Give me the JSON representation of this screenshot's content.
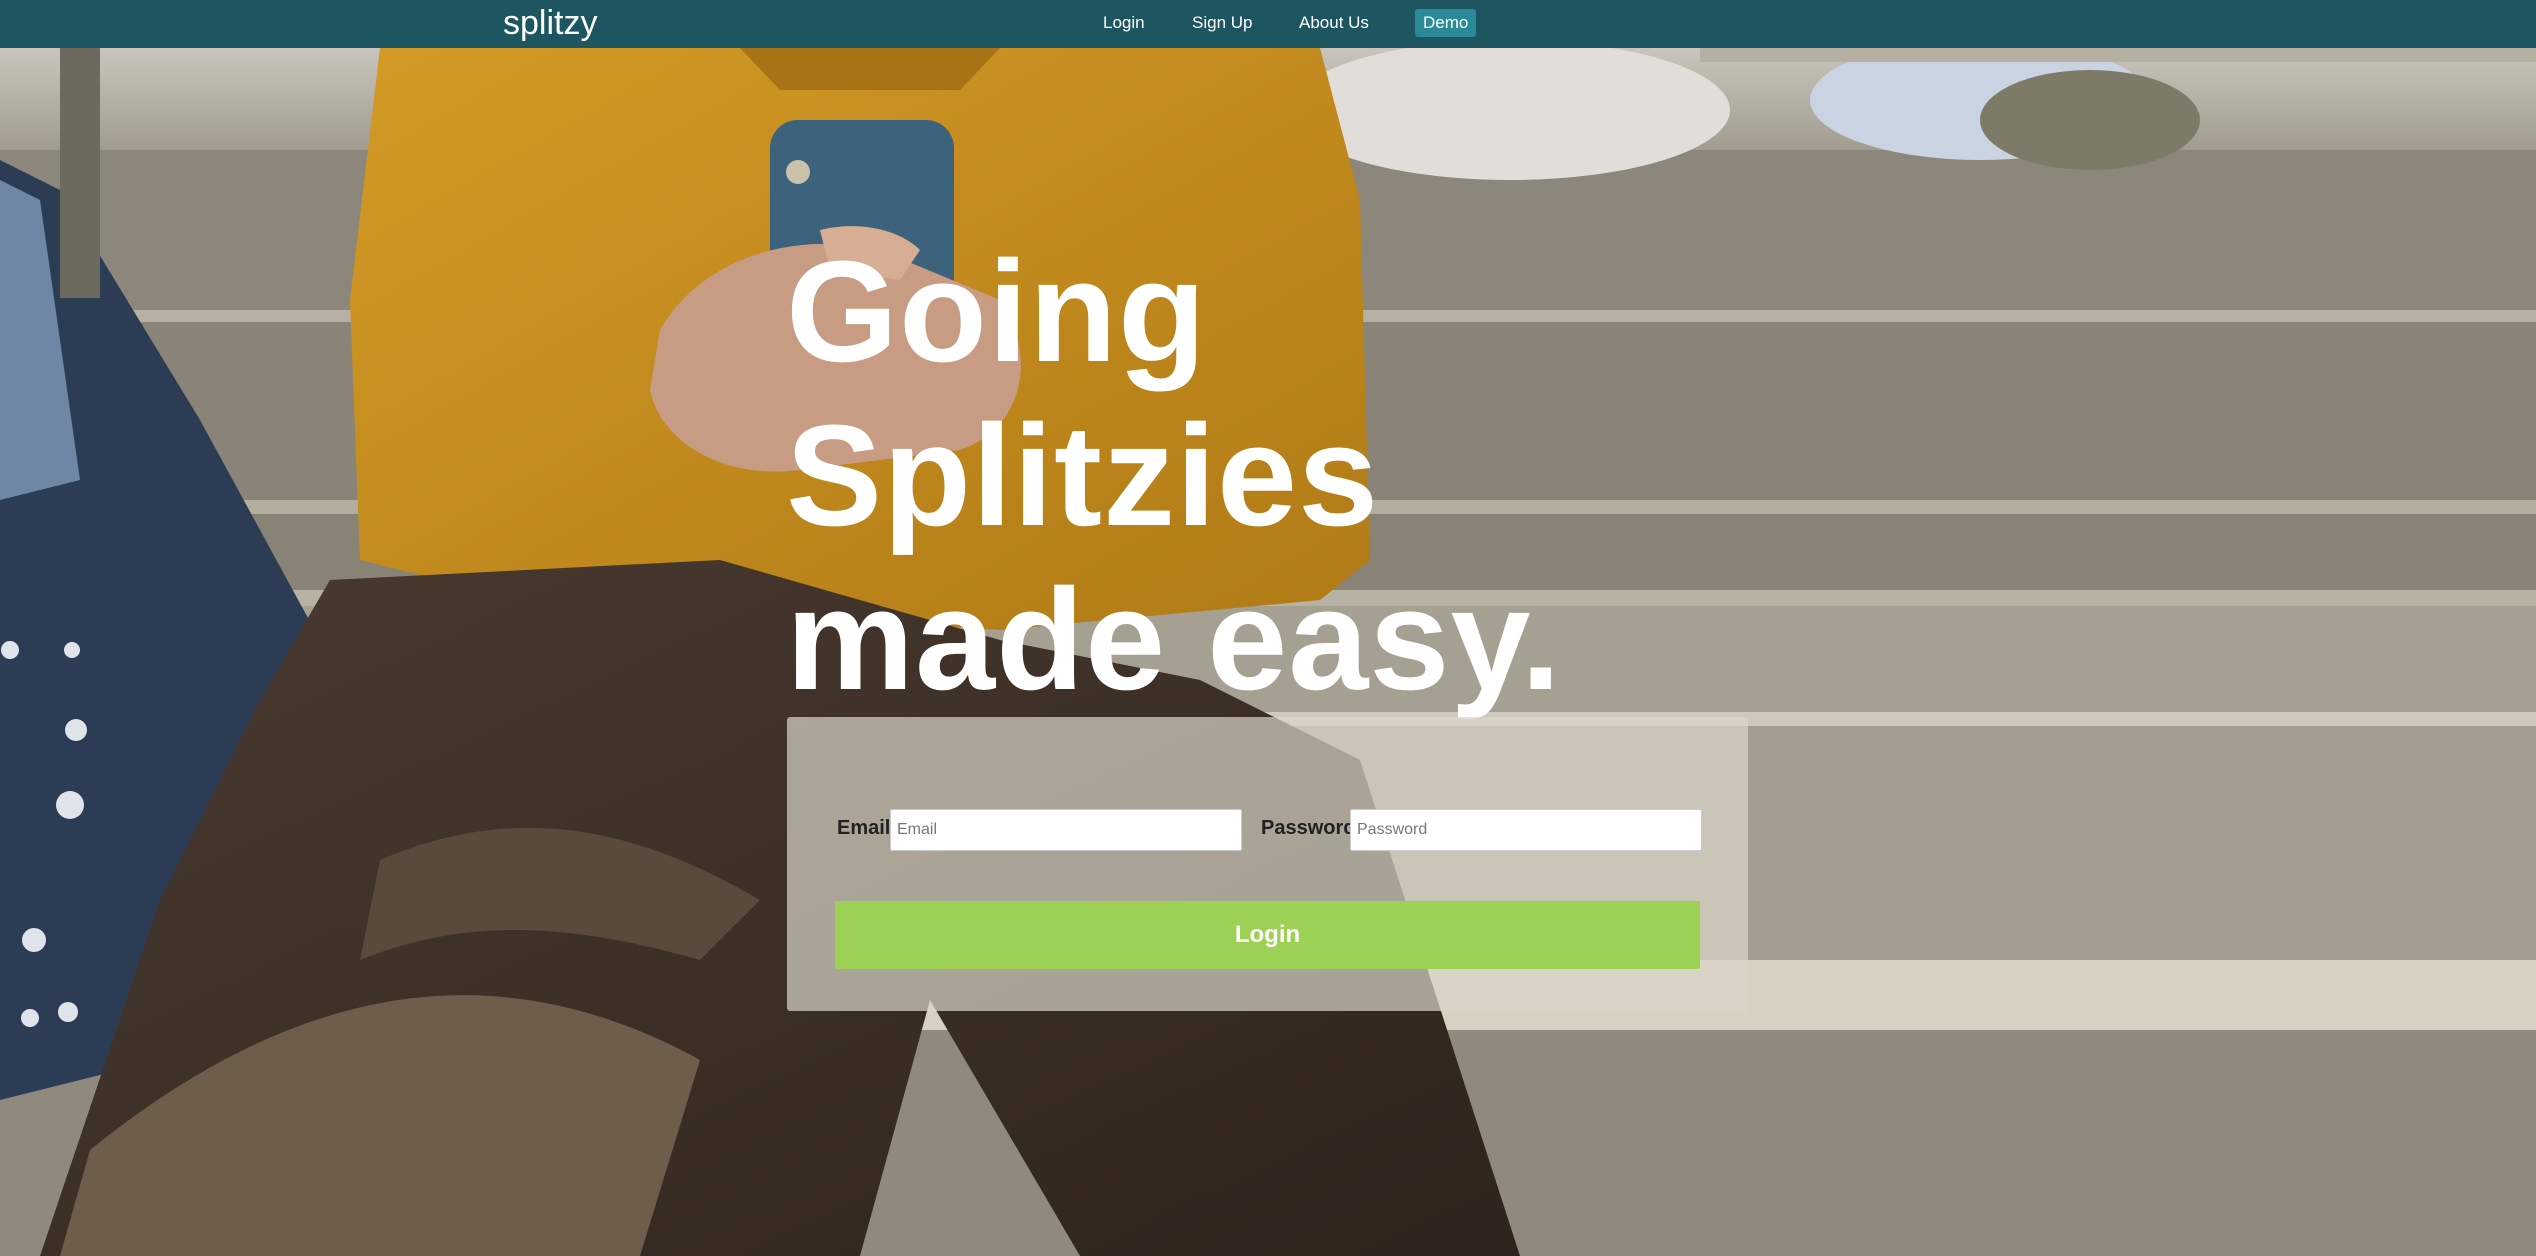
{
  "navbar": {
    "brand": "splitzy",
    "links": {
      "login": "Login",
      "signup": "Sign Up",
      "about": "About Us",
      "demo": "Demo"
    },
    "colors": {
      "background": "#1d5661",
      "demo_badge": "#2a8a98"
    }
  },
  "hero": {
    "headline_lines": [
      "Going",
      "Splitzies",
      "made easy."
    ]
  },
  "login_form": {
    "email_label": "Email",
    "email_placeholder": "Email",
    "password_label": "Password",
    "password_placeholder": "Password",
    "submit_label": "Login",
    "colors": {
      "submit": "#9dd155"
    }
  },
  "background": {
    "description_icon": "photo-person-on-stairs-with-phone"
  }
}
